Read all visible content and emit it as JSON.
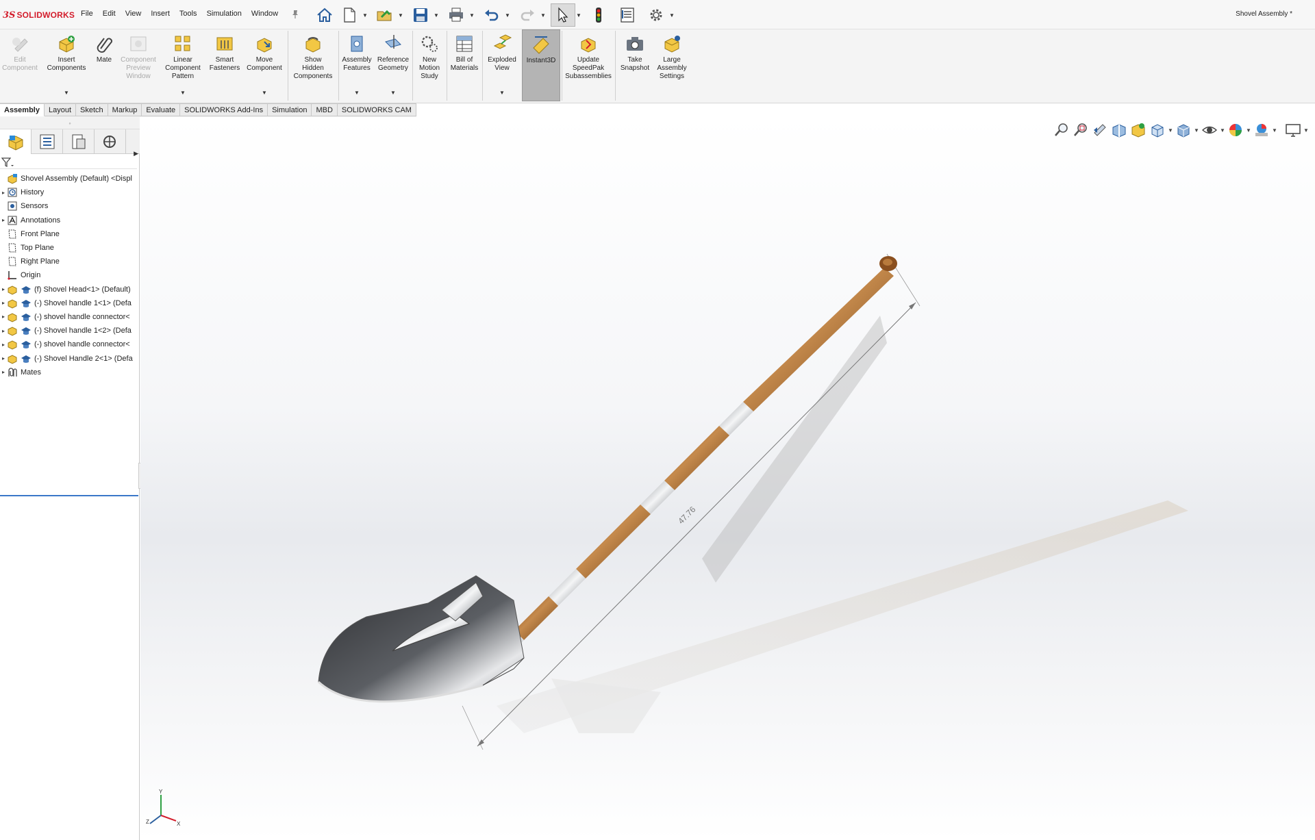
{
  "app": {
    "brand_prefix": "3S",
    "brand_name": "SOLIDWORKS",
    "document_title": "Shovel Assembly *"
  },
  "menu": [
    "File",
    "Edit",
    "View",
    "Insert",
    "Tools",
    "Simulation",
    "Window"
  ],
  "ribbon": {
    "edit_component": "Edit\nComponent",
    "insert_components": "Insert\nComponents",
    "mate": "Mate",
    "component_preview_window": "Component\nPreview\nWindow",
    "linear_component_pattern": "Linear\nComponent\nPattern",
    "smart_fasteners": "Smart\nFasteners",
    "move_component": "Move\nComponent",
    "show_hidden_components": "Show\nHidden\nComponents",
    "assembly_features": "Assembly\nFeatures",
    "reference_geometry": "Reference\nGeometry",
    "new_motion_study": "New\nMotion\nStudy",
    "bill_of_materials": "Bill of\nMaterials",
    "exploded_view": "Exploded\nView",
    "instant3d": "Instant3D",
    "update_speedpak": "Update\nSpeedPak\nSubassemblies",
    "take_snapshot": "Take\nSnapshot",
    "large_assembly_settings": "Large\nAssembly\nSettings"
  },
  "tabs": [
    "Assembly",
    "Layout",
    "Sketch",
    "Markup",
    "Evaluate",
    "SOLIDWORKS Add-Ins",
    "Simulation",
    "MBD",
    "SOLIDWORKS CAM"
  ],
  "tree": [
    {
      "label": "Shovel Assembly (Default) <Displ",
      "icon": "assembly-icon",
      "expand": false,
      "indent": 0
    },
    {
      "label": "History",
      "icon": "history-icon",
      "expand": true,
      "indent": 1
    },
    {
      "label": "Sensors",
      "icon": "sensors-icon",
      "expand": false,
      "indent": 1
    },
    {
      "label": "Annotations",
      "icon": "annotations-icon",
      "expand": true,
      "indent": 1
    },
    {
      "label": "Front Plane",
      "icon": "plane-icon",
      "expand": false,
      "indent": 1
    },
    {
      "label": "Top Plane",
      "icon": "plane-icon",
      "expand": false,
      "indent": 1
    },
    {
      "label": "Right Plane",
      "icon": "plane-icon",
      "expand": false,
      "indent": 1
    },
    {
      "label": "Origin",
      "icon": "origin-icon",
      "expand": false,
      "indent": 1
    },
    {
      "label": "(f) Shovel Head<1> (Default)",
      "icon": "part-icon",
      "expand": true,
      "indent": 1
    },
    {
      "label": "(-) Shovel handle 1<1> (Defa",
      "icon": "part-icon",
      "expand": true,
      "indent": 1
    },
    {
      "label": "(-) shovel handle connector<",
      "icon": "part-icon",
      "expand": true,
      "indent": 1
    },
    {
      "label": "(-) Shovel handle 1<2> (Defa",
      "icon": "part-icon",
      "expand": true,
      "indent": 1
    },
    {
      "label": "(-) shovel handle connector<",
      "icon": "part-icon",
      "expand": true,
      "indent": 1
    },
    {
      "label": "(-) Shovel Handle 2<1> (Defa",
      "icon": "part-icon",
      "expand": true,
      "indent": 1
    },
    {
      "label": "Mates",
      "icon": "mates-icon",
      "expand": true,
      "indent": 1
    }
  ],
  "viewport": {
    "dimension_value": "47.76",
    "triad_labels": {
      "x": "X",
      "y": "Y",
      "z": "Z"
    }
  },
  "colors": {
    "brand": "#d31c2b",
    "wood": "#a0632a",
    "metal": "#c9ccd0",
    "active_tab_underline": "#3a77c8"
  }
}
